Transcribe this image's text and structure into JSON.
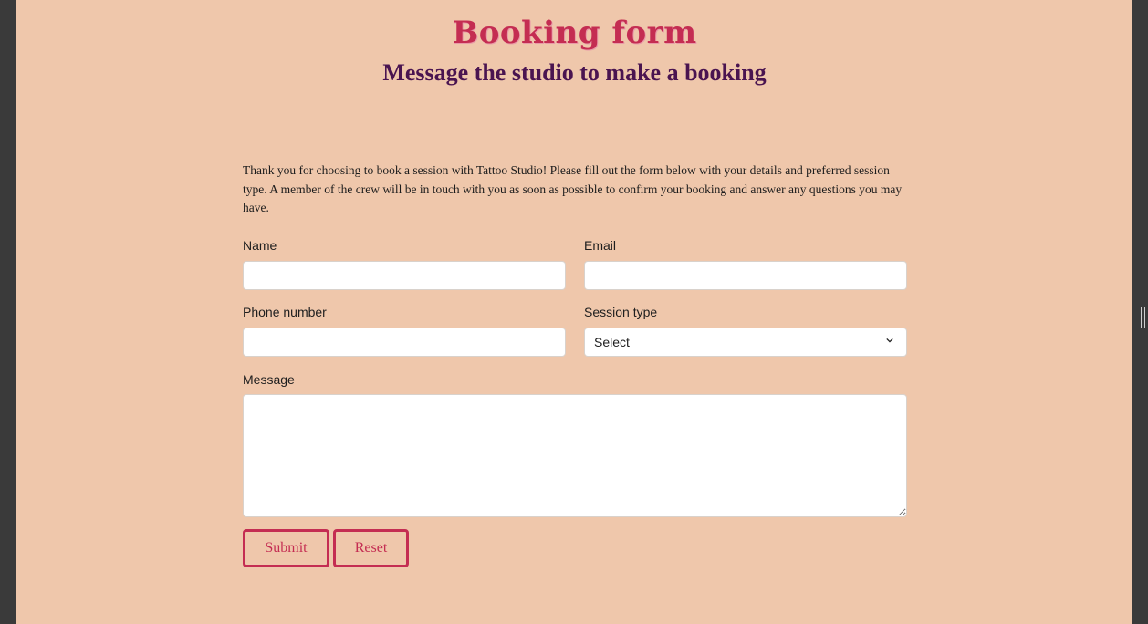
{
  "header": {
    "title": "Booking form",
    "subtitle": "Message the studio to make a booking"
  },
  "intro": {
    "text": "Thank you for choosing to book a session with Tattoo Studio! Please fill out the form below with your details and preferred session type. A member of the crew will be in touch with you as soon as possible to confirm your booking and answer any questions you may have."
  },
  "form": {
    "name_label": "Name",
    "name_value": "",
    "email_label": "Email",
    "email_value": "",
    "phone_label": "Phone number",
    "phone_value": "",
    "session_label": "Session type",
    "session_selected": "Select",
    "message_label": "Message",
    "message_value": "",
    "submit_label": "Submit",
    "reset_label": "Reset"
  },
  "colors": {
    "background": "#efc7ab",
    "accent": "#c42d52",
    "subtitle": "#4a1450"
  }
}
